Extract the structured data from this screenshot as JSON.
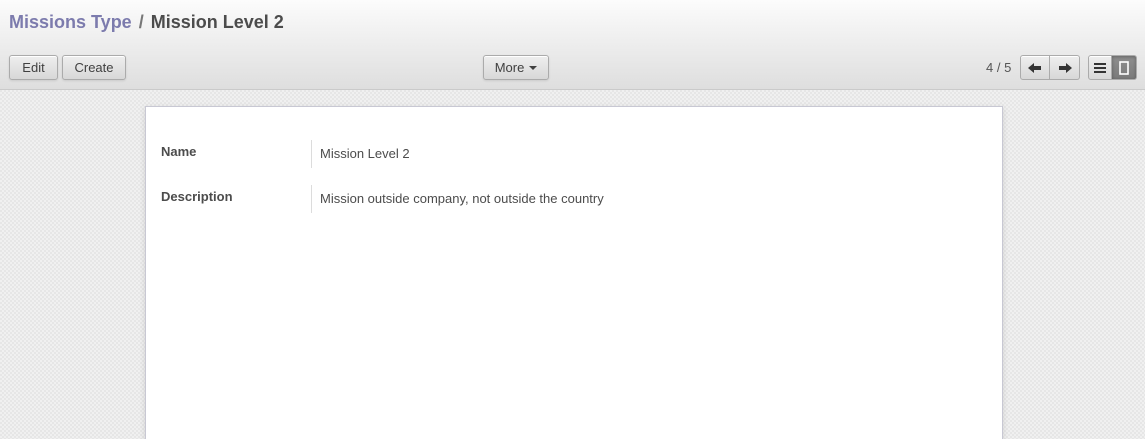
{
  "breadcrumb": {
    "parent": "Missions Type",
    "separator": "/",
    "current": "Mission Level 2"
  },
  "toolbar": {
    "edit_label": "Edit",
    "create_label": "Create",
    "more_label": "More"
  },
  "pager": {
    "value": "4 / 5"
  },
  "view_switcher": {
    "options": [
      "list-view-icon",
      "form-view-icon"
    ],
    "active": "form-view-icon"
  },
  "form": {
    "fields": [
      {
        "label": "Name",
        "value": "Mission Level 2"
      },
      {
        "label": "Description",
        "value": "Mission outside company, not outside the country"
      }
    ]
  },
  "colors": {
    "breadcrumb_link": "#7c7bad",
    "text": "#4c4c4c"
  }
}
